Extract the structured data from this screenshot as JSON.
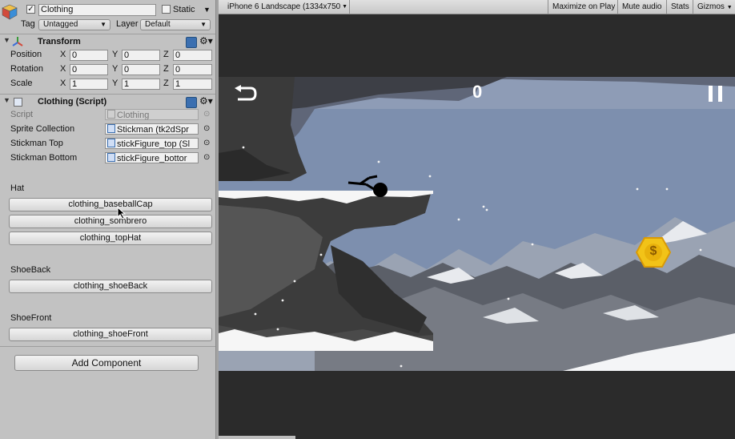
{
  "inspector": {
    "object_name": "Clothing",
    "static_label": "Static",
    "tag_label": "Tag",
    "tag_value": "Untagged",
    "layer_label": "Layer",
    "layer_value": "Default",
    "transform": {
      "title": "Transform",
      "rows": [
        {
          "label": "Position",
          "x": "0",
          "y": "0",
          "z": "0"
        },
        {
          "label": "Rotation",
          "x": "0",
          "y": "0",
          "z": "0"
        },
        {
          "label": "Scale",
          "x": "1",
          "y": "1",
          "z": "1"
        }
      ],
      "axis_labels": [
        "X",
        "Y",
        "Z"
      ]
    },
    "script_component": {
      "title": "Clothing (Script)",
      "script_label": "Script",
      "script_value": "Clothing",
      "sprite_collection_label": "Sprite Collection",
      "sprite_collection_value": "Stickman (tk2dSpr",
      "stickman_top_label": "Stickman Top",
      "stickman_top_value": "stickFigure_top (Sl",
      "stickman_bottom_label": "Stickman Bottom",
      "stickman_bottom_value": "stickFigure_bottor"
    },
    "sections": [
      {
        "title": "Hat",
        "buttons": [
          "clothing_baseballCap",
          "clothing_sombrero",
          "clothing_topHat"
        ]
      },
      {
        "title": "ShoeBack",
        "buttons": [
          "clothing_shoeBack"
        ]
      },
      {
        "title": "ShoeFront",
        "buttons": [
          "clothing_shoeFront"
        ]
      }
    ],
    "add_component": "Add Component"
  },
  "game_view": {
    "aspect": "iPhone 6 Landscape (1334x750",
    "maximize": "Maximize on Play",
    "mute": "Mute audio",
    "stats": "Stats",
    "gizmos": "Gizmos",
    "score": "0",
    "coin_symbol": "$"
  },
  "colors": {
    "panel": "#c2c2c2",
    "sky": "#7d8fae",
    "rock_dark": "#3a3a3a",
    "coin": "#f2c318"
  }
}
